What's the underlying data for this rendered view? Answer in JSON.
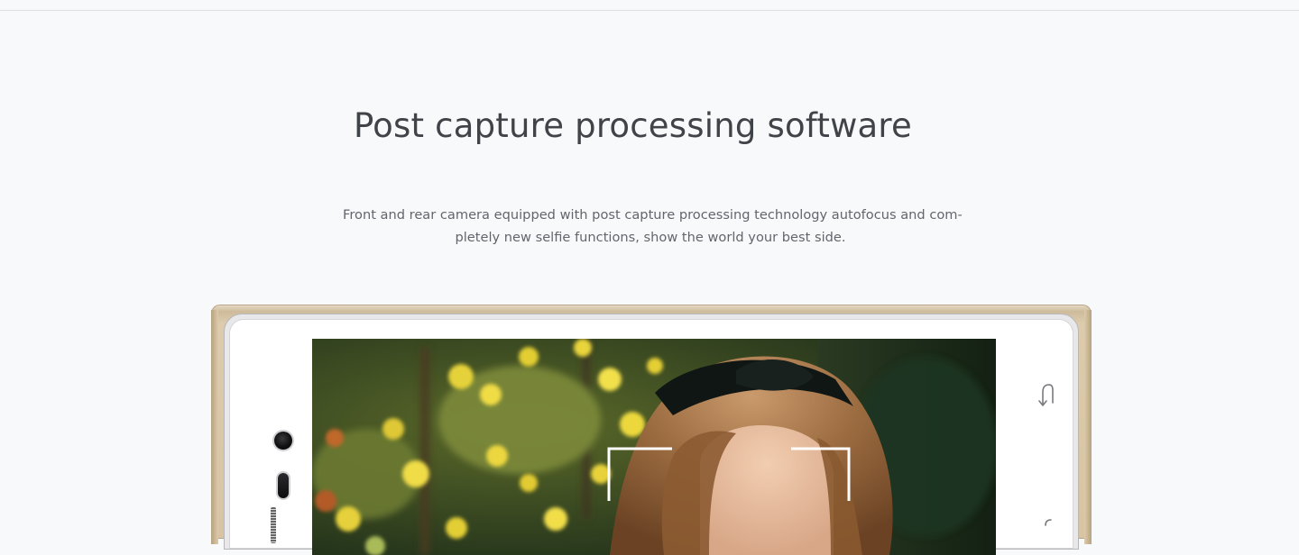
{
  "section": {
    "title": "Post capture processing software",
    "description_lines": [
      "Front and rear camera equipped with post capture processing technology autofocus and com-",
      "pletely new selfie functions, show the world your best side."
    ]
  },
  "phone": {
    "icons": [
      "front-camera-icon",
      "proximity-sensor-icon",
      "earpiece-speaker-icon",
      "back-nav-icon",
      "recent-nav-icon"
    ],
    "screen_image": "selfie-photo-with-focus-frame"
  },
  "colors": {
    "background": "#f8f9fb",
    "title": "#404348",
    "body_text": "#62666c",
    "phone_gold": "#d6c4a4"
  }
}
